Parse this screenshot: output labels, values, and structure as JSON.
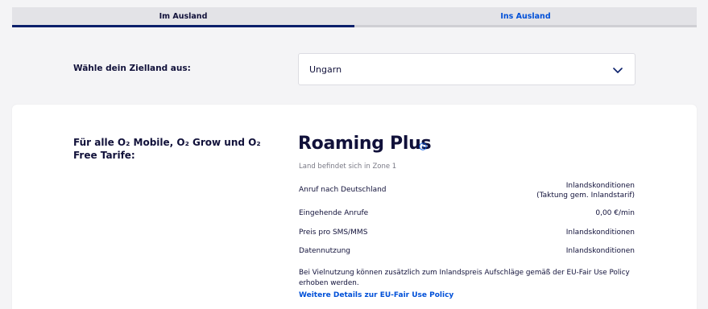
{
  "tabs": [
    {
      "label": "Im Ausland",
      "active": true
    },
    {
      "label": "Ins Ausland",
      "active": false
    }
  ],
  "destination": {
    "label": "Wähle dein Zielland aus:",
    "selected": "Ungarn"
  },
  "card": {
    "applies_to": "Für alle O₂ Mobile, O₂ Grow und O₂ Free Tarife:",
    "plan_name": "Roaming Plus",
    "zone_note": "Land befindet sich in Zone 1",
    "rows": [
      {
        "label": "Anruf nach Deutschland",
        "value_line1": "Inlandskonditionen",
        "value_line2": "(Taktung gem. Inlandstarif)"
      },
      {
        "label": "Eingehende Anrufe",
        "value_line1": "0,00 €/min"
      },
      {
        "label": "Preis pro SMS/MMS",
        "value_line1": "Inlandskonditionen"
      },
      {
        "label": "Datennutzung",
        "value_line1": "Inlandskonditionen"
      }
    ],
    "fair_use_note": "Bei Vielnutzung können zusätzlich zum Inlandspreis Aufschläge gemäß der EU-Fair Use Policy erhoben werden.",
    "fair_use_link": "Weitere Details zur EU-Fair Use Policy"
  },
  "colors": {
    "accent": "#0050d8",
    "navy": "#0a1f6b",
    "text": "#11113a"
  }
}
